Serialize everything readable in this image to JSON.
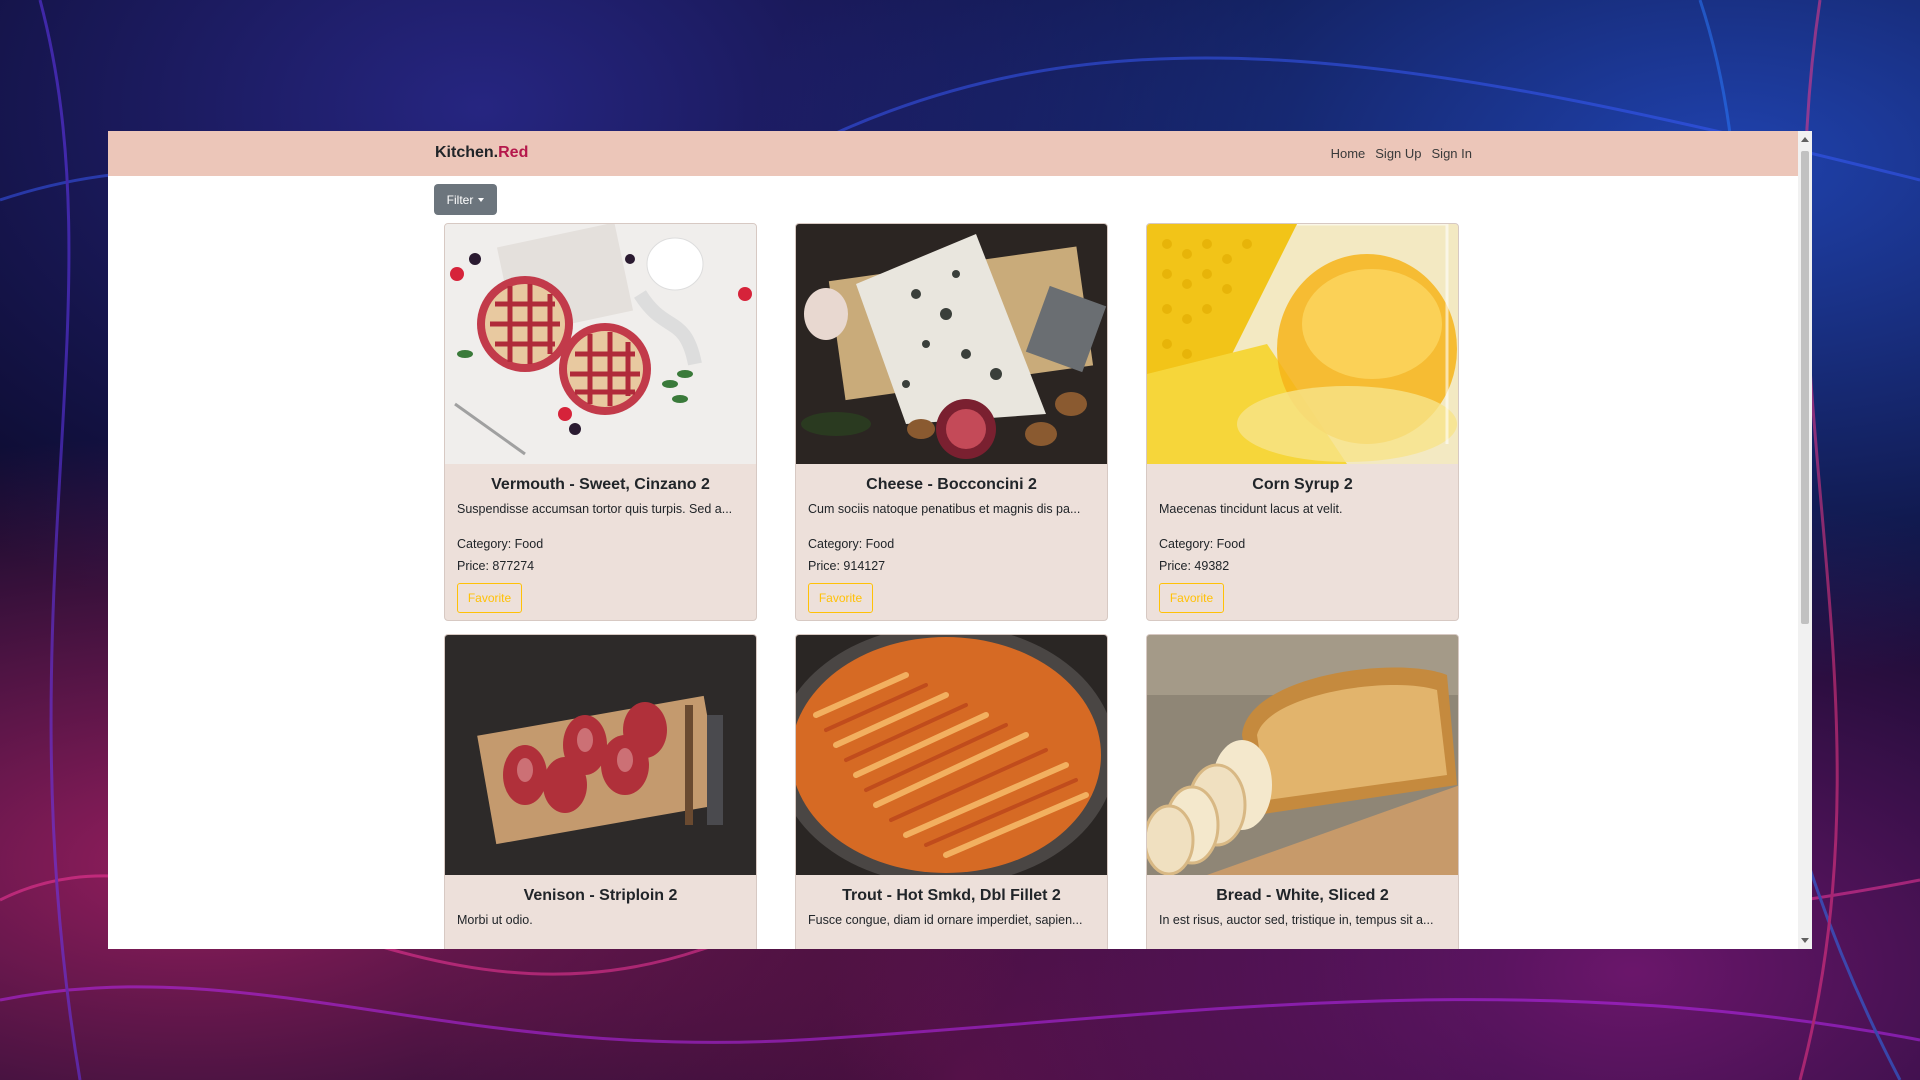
{
  "navbar": {
    "brand_main": "Kitchen.",
    "brand_accent": "Red",
    "links": [
      "Home",
      "Sign Up",
      "Sign In"
    ]
  },
  "filter": {
    "label": "Filter"
  },
  "products": [
    {
      "title": "Vermouth - Sweet, Cinzano 2",
      "description": "Suspendisse accumsan tortor quis turpis. Sed a...",
      "category_label": "Category: Food",
      "price_label": "Price: 877274",
      "favorite_label": "Favorite",
      "image": "pie-photo"
    },
    {
      "title": "Cheese - Bocconcini 2",
      "description": "Cum sociis natoque penatibus et magnis dis pa...",
      "category_label": "Category: Food",
      "price_label": "Price: 914127",
      "favorite_label": "Favorite",
      "image": "cheese-photo"
    },
    {
      "title": "Corn Syrup 2",
      "description": "Maecenas tincidunt lacus at velit.",
      "category_label": "Category: Food",
      "price_label": "Price: 49382",
      "favorite_label": "Favorite",
      "image": "corn-photo"
    },
    {
      "title": "Venison - Striploin 2",
      "description": "Morbi ut odio.",
      "category_label": "",
      "price_label": "",
      "favorite_label": "",
      "image": "meat-photo"
    },
    {
      "title": "Trout - Hot Smkd, Dbl Fillet 2",
      "description": "Fusce congue, diam id ornare imperdiet, sapien...",
      "category_label": "",
      "price_label": "",
      "favorite_label": "",
      "image": "fish-photo"
    },
    {
      "title": "Bread - White, Sliced 2",
      "description": "In est risus, auctor sed, tristique in, tempus sit a...",
      "category_label": "",
      "price_label": "",
      "favorite_label": "",
      "image": "bread-photo"
    }
  ],
  "colors": {
    "navbar_bg": "#ecc6b9",
    "brand_accent": "#b5174b",
    "card_bg": "#ede0da",
    "favorite": "#ffc107",
    "filter_bg": "#6c757d"
  }
}
